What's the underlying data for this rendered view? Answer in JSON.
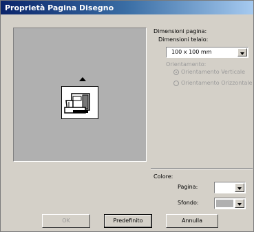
{
  "window": {
    "title": "Proprietà Pagina Disegno"
  },
  "page_size": {
    "heading": "Dimensioni pagina:",
    "frame_label": "Dimensioni telaio:",
    "frame_value": "100 x 100 mm"
  },
  "orientation": {
    "heading": "Orientamento:",
    "options": [
      "Orientamento Verticale",
      "Orientamento Orizzontale"
    ],
    "selected": "Orientamento Verticale",
    "enabled": false
  },
  "color": {
    "heading": "Colore:",
    "page_label": "Pagina:",
    "background_label": "Sfondo:",
    "page_color": "#ffffff",
    "background_color": "#b0b0b0"
  },
  "buttons": {
    "ok": "OK",
    "default": "Predefinito",
    "cancel": "Annulla"
  },
  "colors": {
    "title_start": "#0a246a",
    "preview_bg": "#b0b0b0"
  }
}
